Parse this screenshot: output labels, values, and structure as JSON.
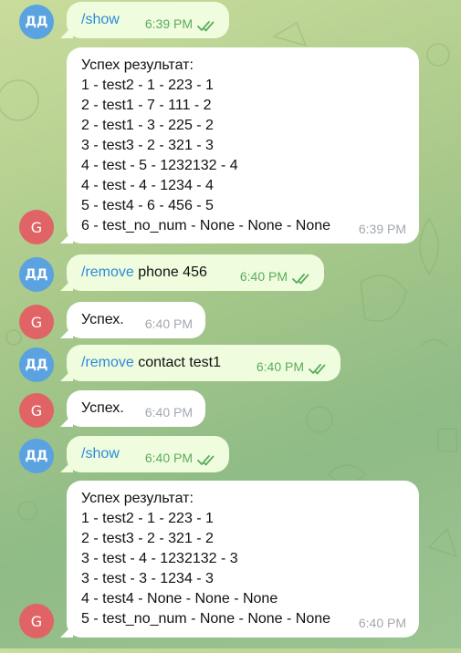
{
  "messages": [
    {
      "type": "out",
      "avatar": "ДД",
      "command": "/show",
      "text": "",
      "time": "6:39 PM"
    },
    {
      "type": "in",
      "avatar": "G",
      "lines": [
        "Успех результат:",
        "1 - test2 - 1 - 223 - 1",
        "2 - test1 - 7 - 111 - 2",
        "2 - test1 - 3 - 225 - 2",
        "3 - test3 - 2 - 321 - 3",
        "4 - test - 5 - 1232132 - 4",
        "4 - test - 4 - 1234 - 4",
        "5 - test4 - 6 - 456 - 5",
        "6 - test_no_num - None - None - None"
      ],
      "time": "6:39 PM"
    },
    {
      "type": "out",
      "avatar": "ДД",
      "command": "/remove",
      "text": " phone 456",
      "time": "6:40 PM"
    },
    {
      "type": "in",
      "avatar": "G",
      "lines": [
        "Успех."
      ],
      "time": "6:40 PM"
    },
    {
      "type": "out",
      "avatar": "ДД",
      "command": "/remove",
      "text": " contact test1",
      "time": "6:40 PM"
    },
    {
      "type": "in",
      "avatar": "G",
      "lines": [
        "Успех."
      ],
      "time": "6:40 PM"
    },
    {
      "type": "out",
      "avatar": "ДД",
      "command": "/show",
      "text": "",
      "time": "6:40 PM"
    },
    {
      "type": "in",
      "avatar": "G",
      "lines": [
        "Успех результат:",
        "1 - test2 - 1 - 223 - 1",
        "2 - test3 - 2 - 321 - 2",
        "3 - test - 4 - 1232132 - 3",
        "3 - test - 3 - 1234 - 3",
        "4 - test4 - None - None - None",
        "5 - test_no_num - None - None - None"
      ],
      "time": "6:40 PM"
    }
  ],
  "colors": {
    "outgoing_bubble": "#effdde",
    "incoming_bubble": "#ffffff",
    "command_link": "#2d8ad8",
    "read_ticks": "#5cab5d",
    "user_avatar": "#5aa2e0",
    "bot_avatar": "#e06466"
  },
  "icons": {
    "read": "double-check-icon"
  }
}
